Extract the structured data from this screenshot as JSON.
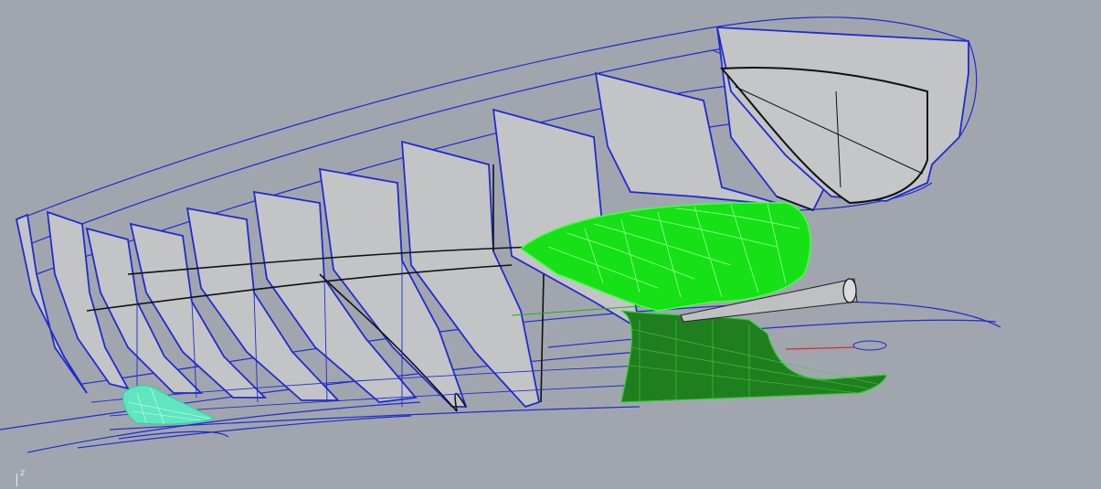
{
  "viewport": {
    "axis_label": "z",
    "background": "#a1a6ae",
    "colors": {
      "wire_blue": "#1f2bd0",
      "section_fill": "#c3c4c6",
      "edge_black": "#111111",
      "surface_green": "#16e016",
      "mesh_bright": "#44ff44",
      "skeg_dark_green": "#1f7f1f",
      "shaft_grey": "#bfc0c2",
      "bulb_cyan": "#5fe6c0"
    }
  }
}
